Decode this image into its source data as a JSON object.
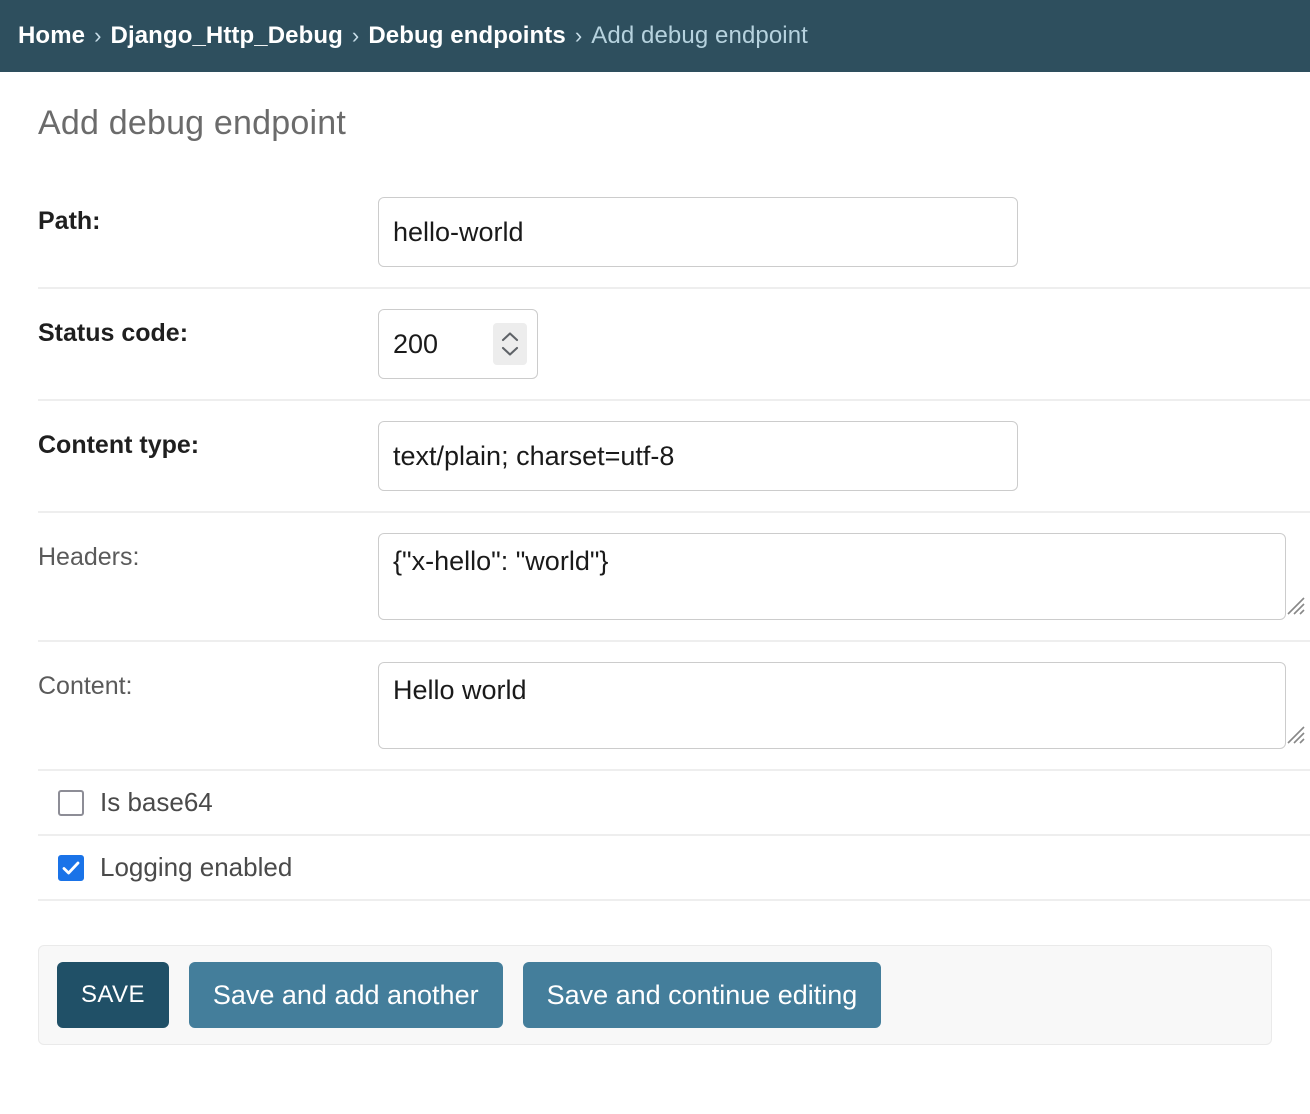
{
  "breadcrumbs": {
    "separator": "›",
    "items": [
      {
        "label": "Home",
        "current": false
      },
      {
        "label": "Django_Http_Debug",
        "current": false
      },
      {
        "label": "Debug endpoints",
        "current": false
      },
      {
        "label": "Add debug endpoint",
        "current": true
      }
    ]
  },
  "page": {
    "title": "Add debug endpoint"
  },
  "form": {
    "rows": [
      {
        "label": "Path:",
        "value": "hello-world"
      },
      {
        "label": "Status code:",
        "value": "200"
      },
      {
        "label": "Content type:",
        "value": "text/plain; charset=utf-8"
      },
      {
        "label": "Headers:",
        "value": "{\"x-hello\": \"world\"}"
      },
      {
        "label": "Content:",
        "value": "Hello world"
      }
    ],
    "checkboxes": [
      {
        "label": "Is base64",
        "checked": "false"
      },
      {
        "label": "Logging enabled",
        "checked": "true"
      }
    ]
  },
  "submit_row": {
    "save": "SAVE",
    "save_and_add_another": "Save and add another",
    "save_and_continue": "Save and continue editing"
  },
  "colors": {
    "header_bg": "#2e4f5e",
    "crumb_current": "#b6d2de",
    "btn_default": "#205067",
    "btn_secondary": "#447e9b",
    "checkbox_on": "#1a73e8",
    "divider": "#eeeeee",
    "submit_row_bg": "#f8f8f8"
  }
}
